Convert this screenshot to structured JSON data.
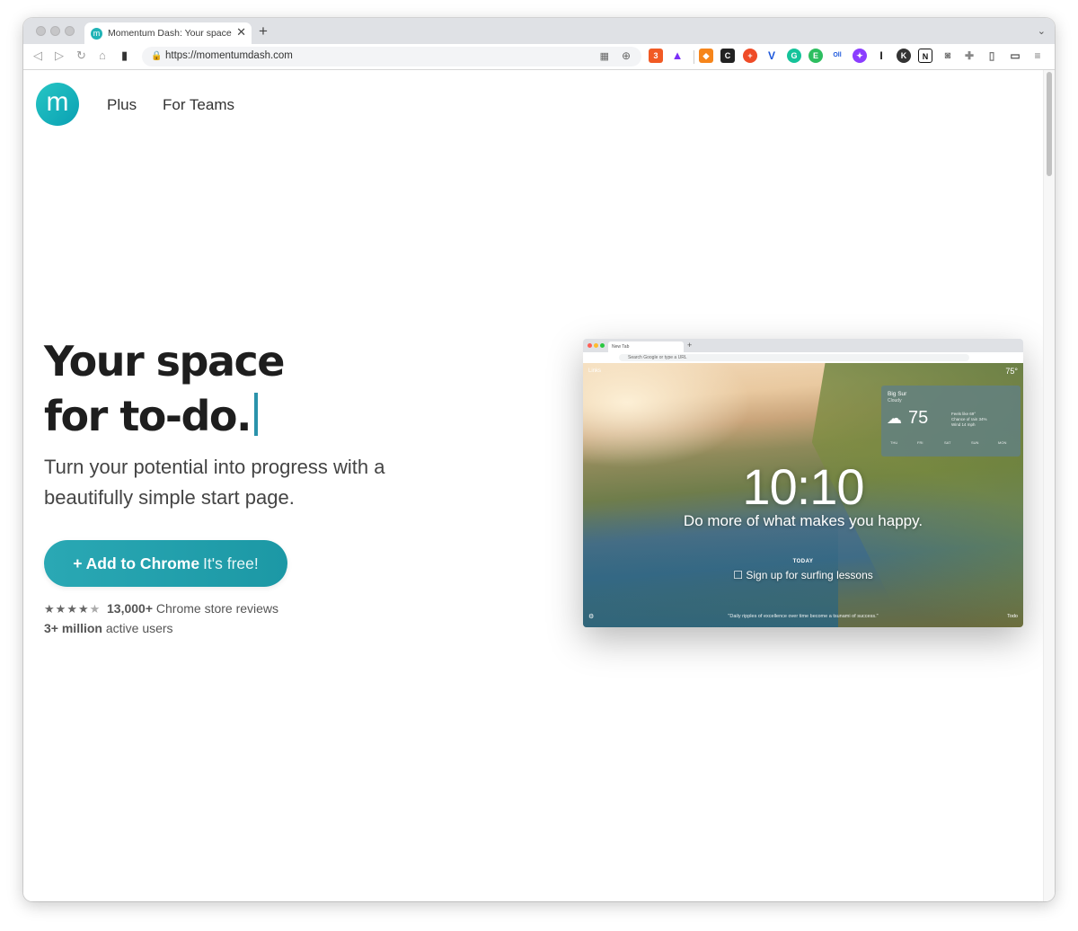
{
  "browser": {
    "tab_title": "Momentum Dash: Your space fo",
    "tab_favicon": "m",
    "url": "https://momentumdash.com",
    "extension_badge": "3"
  },
  "site": {
    "logo_letter": "m",
    "nav": [
      "Plus",
      "For Teams"
    ]
  },
  "hero": {
    "headline_line1": "Your space",
    "headline_line2": "for to-do.",
    "subheadline": "Turn your potential into progress with a beautifully simple start page.",
    "cta_main": "+ Add to Chrome",
    "cta_free": "It's free!",
    "rating_stars": 4.5,
    "reviews_count": "13,000+",
    "reviews_label": "Chrome store reviews",
    "users_count": "3+ million",
    "users_label": "active users"
  },
  "preview": {
    "tab_title": "New Tab",
    "search_placeholder": "Search Google or type a URL",
    "links_label": "Links",
    "top_temp": "75°",
    "weather": {
      "city": "Big Sur",
      "condition": "Cloudy",
      "temp": "75",
      "feels_like": "Feels like 69°",
      "rain": "Chance of rain 34%",
      "wind": "Wind 14 mph",
      "days": [
        "THU",
        "FRI",
        "SAT",
        "SUN",
        "MON"
      ]
    },
    "time": "10:10",
    "mantra": "Do more of what makes you happy.",
    "today_label": "TODAY",
    "todo_item": "Sign up for surfing lessons",
    "quote": "\"Daily ripples of excellence over time become a tsunami of success.\"",
    "todo_link": "Todo"
  },
  "colors": {
    "accent": "#20a6b2",
    "headline": "#1e1e1e",
    "cursor": "#2b93ab"
  }
}
